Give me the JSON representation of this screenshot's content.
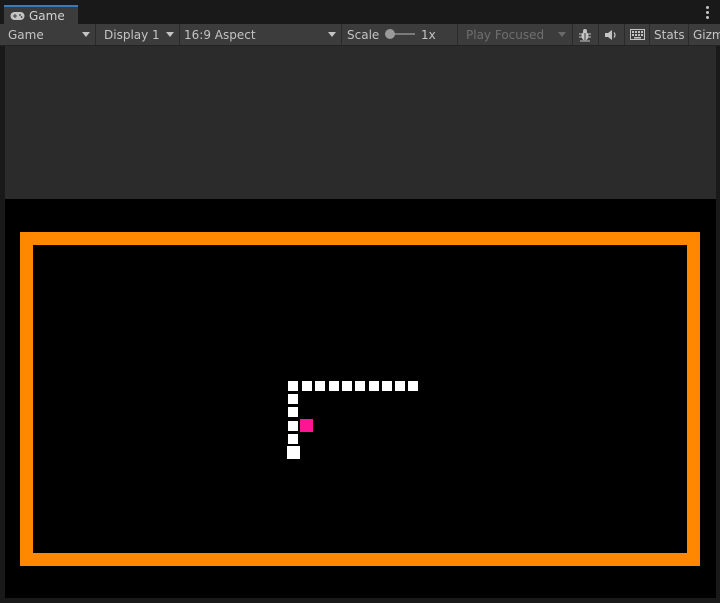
{
  "tab": {
    "label": "Game",
    "icon": "gamepad-icon"
  },
  "toolbar": {
    "view_mode": "Game",
    "display": "Display 1",
    "aspect": "16:9 Aspect",
    "scale_label": "Scale",
    "scale_value": "1x",
    "play_mode": "Play Focused",
    "stats_label": "Stats",
    "gizmos_label": "Gizmos"
  },
  "colors": {
    "wall": "#ff8800",
    "snake": "#ffffff",
    "food": "#ff1493",
    "game_background": "#000000"
  }
}
